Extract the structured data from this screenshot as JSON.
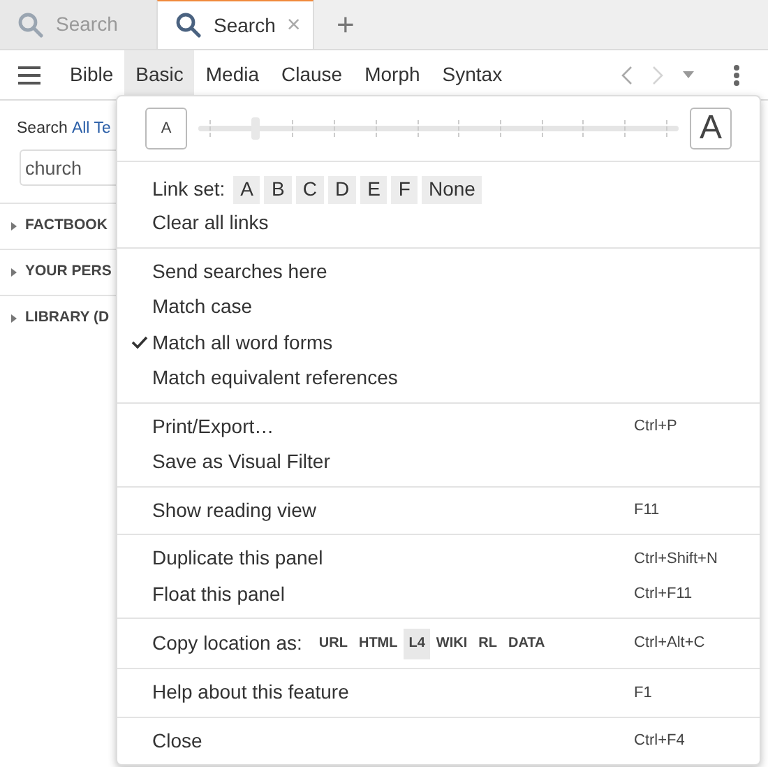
{
  "tabs": [
    {
      "label": "Search",
      "selected": false
    },
    {
      "label": "Search",
      "selected": true,
      "close": "×"
    }
  ],
  "new_tab": "+",
  "toolbar": {
    "items": [
      {
        "label": "Bible",
        "selected": false
      },
      {
        "label": "Basic",
        "selected": true
      },
      {
        "label": "Media",
        "selected": false
      },
      {
        "label": "Clause",
        "selected": false
      },
      {
        "label": "Morph",
        "selected": false
      },
      {
        "label": "Syntax",
        "selected": false
      }
    ]
  },
  "panel": {
    "search_label": "Search",
    "scope_link": "All Te",
    "query": "church",
    "sections": [
      "FACTBOOK",
      "YOUR PERS",
      "LIBRARY (D"
    ]
  },
  "menu": {
    "text_size": {
      "small": "A",
      "large": "A",
      "level": 0.12
    },
    "link_set": {
      "label": "Link set:",
      "options": [
        "A",
        "B",
        "C",
        "D",
        "E",
        "F",
        "None"
      ]
    },
    "groups": [
      [
        {
          "label": "Clear all links"
        }
      ],
      [
        {
          "label": "Send searches here",
          "checked": false
        },
        {
          "label": "Match case",
          "checked": false
        },
        {
          "label": "Match all word forms",
          "checked": true
        },
        {
          "label": "Match equivalent references",
          "checked": false
        }
      ],
      [
        {
          "label": "Print/Export…",
          "shortcut": "Ctrl+P"
        },
        {
          "label": "Save as Visual Filter"
        }
      ],
      [
        {
          "label": "Show reading view",
          "shortcut": "F11"
        }
      ],
      [
        {
          "label": "Duplicate this panel",
          "shortcut": "Ctrl+Shift+N"
        },
        {
          "label": "Float this panel",
          "shortcut": "Ctrl+F11"
        }
      ]
    ],
    "copy_location": {
      "label": "Copy location as:",
      "shortcut": "Ctrl+Alt+C",
      "formats": [
        {
          "label": "URL",
          "selected": false
        },
        {
          "label": "HTML",
          "selected": false
        },
        {
          "label": "L4",
          "selected": true
        },
        {
          "label": "WIKI",
          "selected": false
        },
        {
          "label": "RL",
          "selected": false
        },
        {
          "label": "DATA",
          "selected": false
        }
      ]
    },
    "tail": [
      [
        {
          "label": "Help about this feature",
          "shortcut": "F1"
        }
      ],
      [
        {
          "label": "Close",
          "shortcut": "Ctrl+F4"
        }
      ]
    ]
  }
}
